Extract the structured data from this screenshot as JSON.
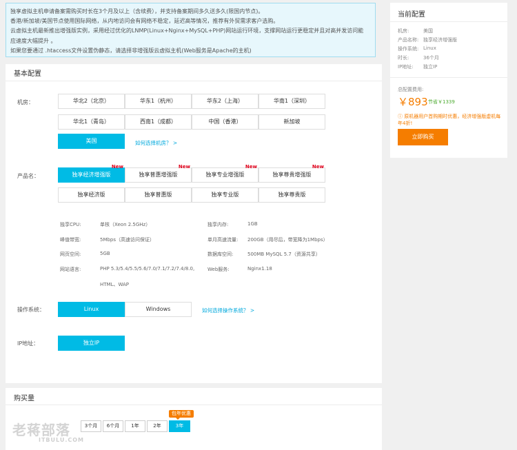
{
  "notice": {
    "lines": [
      "独享虚拟主机申请备案需购买时长在3个月及以上（含续费），并支持备案期间多久送多久(限国内节点)。",
      "香港/新加坡/美国节点使用国际网络，从内地访问会有网络不稳定，延迟高等情况，推荐有外贸需求客户选购。",
      "云虚拟主机最新推出增强版实例，采用经过优化的LNMP(Linux+Nginx+MySQL+PHP)网站运行环境，支撑网站运行更稳定并且对高并发访问能",
      "应速度大幅提升 。",
      "如果您要通过 .htaccess文件设置伪静态，请选择非增强版云虚拟主机(Web服务是Apache的主机)"
    ]
  },
  "basic": {
    "title": "基本配置",
    "region_label": "机房：",
    "regions": [
      "华北2（北京）",
      "华东1（杭州）",
      "华东2（上海）",
      "华南1（深圳）",
      "华北1（青岛）",
      "西南1（成都）",
      "中国（香港）",
      "新加坡",
      "美国"
    ],
    "region_help": "如何选择机房？ >",
    "product_label": "产品名：",
    "products": [
      "独享经济增强版",
      "独享普惠增强版",
      "独享专业增强版",
      "独享尊贵增强版",
      "独享经济版",
      "独享普惠版",
      "独享专业版",
      "独享尊贵版"
    ],
    "new_badge": "New",
    "specs_left": [
      {
        "k": "独享CPU:",
        "v": "单核（Xeon 2.5GHz）"
      },
      {
        "k": "峰值带宽:",
        "v": "5Mbps（高速访问保证）"
      },
      {
        "k": "网页空间:",
        "v": "5GB"
      },
      {
        "k": "网站语言:",
        "v": "PHP 5.3/5.4/5.5/5.6/7.0/7.1/7.2/7.4/8.0,",
        "v2": "HTML、WAP"
      }
    ],
    "specs_right": [
      {
        "k": "独享内存:",
        "v": "1GB"
      },
      {
        "k": "单月高速流量:",
        "v": "200GB（用尽后，带宽降为1Mbps）"
      },
      {
        "k": "数据库空间:",
        "v": "500MB MySQL 5.7（资源共享）"
      },
      {
        "k": "Web服务:",
        "v": "Nginx1.18"
      }
    ],
    "os_label": "操作系统：",
    "os_options": [
      "Linux",
      "Windows"
    ],
    "os_help": "如何选择操作系统？ >",
    "ip_label": "IP地址：",
    "ip_option": "独立IP"
  },
  "purchase": {
    "title": "购买量",
    "durations": [
      "3个月",
      "6个月",
      "1年",
      "2年",
      "3年"
    ],
    "promo": "包年优惠",
    "watermark_cn": "老蒋部落",
    "watermark_en": "ITBULU.COM"
  },
  "summary": {
    "title": "当前配置",
    "items": [
      {
        "k": "机房:",
        "v": "美国"
      },
      {
        "k": "产品名称:",
        "v": "独享经济增强版"
      },
      {
        "k": "操作系统:",
        "v": "Linux"
      },
      {
        "k": "时长:",
        "v": "36个月"
      },
      {
        "k": "IP地址:",
        "v": "独立IP"
      }
    ],
    "total_label": "总配置费用:",
    "price": "￥893",
    "save": "节省￥1339",
    "warn": "ⓘ 原机器用户首购期时优惠，经济增强版虚机每年4折!",
    "buy_button": "立即购买"
  },
  "colors": {
    "accent": "#00bbe5",
    "orange": "#f57d00",
    "new_red": "#e0001b"
  }
}
